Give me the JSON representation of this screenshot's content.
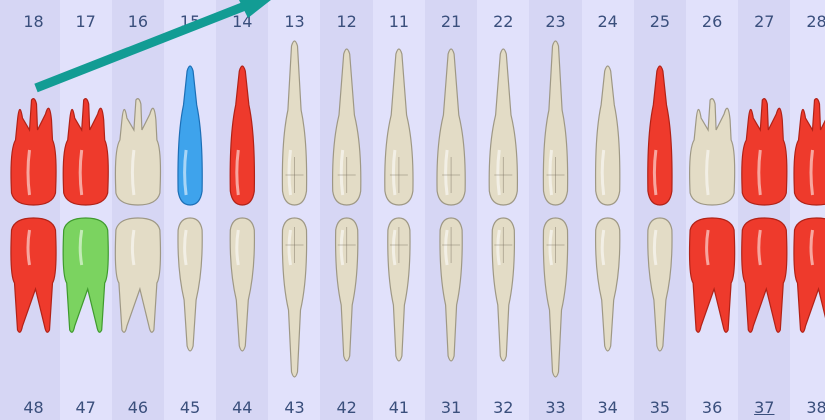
{
  "colors": {
    "background": "#d6d6f4",
    "column_alt": "#e1e1fb",
    "number_text": "#3a4f7c",
    "healthy": "#e3dcc6",
    "red": "#ee3a2c",
    "blue": "#3ea3ec",
    "green": "#7bd360",
    "arrow": "#129c94"
  },
  "upper": [
    {
      "num": "18",
      "type": "molar",
      "status": "red"
    },
    {
      "num": "17",
      "type": "molar",
      "status": "red"
    },
    {
      "num": "16",
      "type": "molar",
      "status": "healthy"
    },
    {
      "num": "15",
      "type": "premolar",
      "status": "blue"
    },
    {
      "num": "14",
      "type": "premolar",
      "status": "red"
    },
    {
      "num": "13",
      "type": "canine",
      "status": "healthy"
    },
    {
      "num": "12",
      "type": "incisor",
      "status": "healthy"
    },
    {
      "num": "11",
      "type": "incisor",
      "status": "healthy"
    },
    {
      "num": "21",
      "type": "incisor",
      "status": "healthy"
    },
    {
      "num": "22",
      "type": "incisor",
      "status": "healthy"
    },
    {
      "num": "23",
      "type": "canine",
      "status": "healthy"
    },
    {
      "num": "24",
      "type": "premolar",
      "status": "healthy"
    },
    {
      "num": "25",
      "type": "premolar",
      "status": "red"
    },
    {
      "num": "26",
      "type": "molar",
      "status": "healthy"
    },
    {
      "num": "27",
      "type": "molar",
      "status": "red"
    },
    {
      "num": "28",
      "type": "molar",
      "status": "red"
    }
  ],
  "lower": [
    {
      "num": "48",
      "type": "molar",
      "status": "red"
    },
    {
      "num": "47",
      "type": "molar",
      "status": "green"
    },
    {
      "num": "46",
      "type": "molar",
      "status": "healthy"
    },
    {
      "num": "45",
      "type": "premolar",
      "status": "healthy"
    },
    {
      "num": "44",
      "type": "premolar",
      "status": "healthy"
    },
    {
      "num": "43",
      "type": "canine",
      "status": "healthy"
    },
    {
      "num": "42",
      "type": "incisor",
      "status": "healthy"
    },
    {
      "num": "41",
      "type": "incisor",
      "status": "healthy"
    },
    {
      "num": "31",
      "type": "incisor",
      "status": "healthy"
    },
    {
      "num": "32",
      "type": "incisor",
      "status": "healthy"
    },
    {
      "num": "33",
      "type": "canine",
      "status": "healthy"
    },
    {
      "num": "34",
      "type": "premolar",
      "status": "healthy"
    },
    {
      "num": "35",
      "type": "premolar",
      "status": "healthy"
    },
    {
      "num": "36",
      "type": "molar",
      "status": "red"
    },
    {
      "num": "37",
      "type": "molar",
      "status": "red",
      "link": true
    },
    {
      "num": "38",
      "type": "molar",
      "status": "red"
    }
  ],
  "annotation": {
    "type": "arrow",
    "color": "#129c94"
  }
}
